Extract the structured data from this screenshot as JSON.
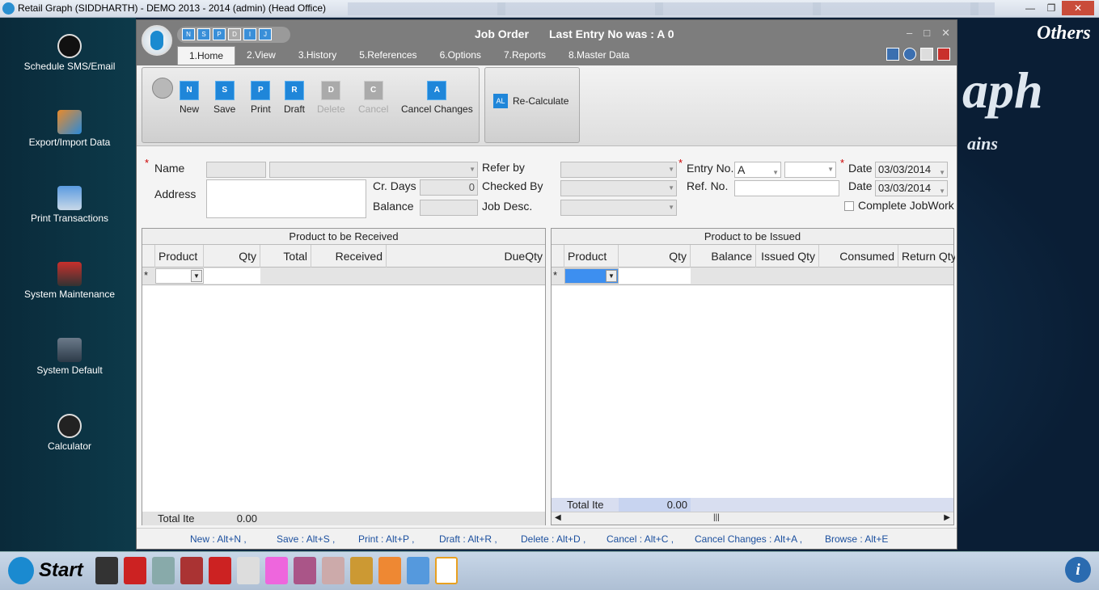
{
  "window": {
    "title": "Retail Graph (SIDDHARTH) - DEMO  2013 - 2014 (admin) (Head Office)"
  },
  "desktop": {
    "icons": [
      {
        "label": "Schedule SMS/Email",
        "icon": "clock-icon"
      },
      {
        "label": "Export/Import Data",
        "icon": "export-import-icon"
      },
      {
        "label": "Print Transactions",
        "icon": "printer-icon"
      },
      {
        "label": "System Maintenance",
        "icon": "maintenance-icon"
      },
      {
        "label": "System Default",
        "icon": "system-default-icon"
      },
      {
        "label": "Calculator",
        "icon": "calculator-icon"
      }
    ],
    "others": "Others",
    "brand_big": "aph",
    "brand_sub": "ains"
  },
  "app": {
    "title": "Job Order",
    "last_entry": "Last Entry No was : A 0",
    "tabs": [
      "1.Home",
      "2.View",
      "3.History",
      "5.References",
      "6.Options",
      "7.Reports",
      "8.Master Data"
    ],
    "ribbon": {
      "new": "New",
      "save": "Save",
      "print": "Print",
      "draft": "Draft",
      "delete": "Delete",
      "cancel": "Cancel",
      "cancel_changes": "Cancel Changes",
      "recalculate": "Re-Calculate"
    },
    "form": {
      "name_label": "Name",
      "address_label": "Address",
      "cr_days_label": "Cr. Days",
      "cr_days_value": "0",
      "balance_label": "Balance",
      "refer_by_label": "Refer by",
      "checked_by_label": "Checked By",
      "job_desc_label": "Job Desc.",
      "entry_no_label": "Entry No.",
      "entry_no_value": "A",
      "ref_no_label": "Ref. No.",
      "date_label": "Date",
      "date1": "03/03/2014",
      "date2": "03/03/2014",
      "complete_jobwork": "Complete JobWork"
    },
    "received": {
      "title": "Product to be Received",
      "columns": [
        "Product",
        "Qty",
        "Total Qty",
        "Received Qty",
        "DueQty"
      ],
      "total_label": "Total Ite",
      "total_value": "0.00"
    },
    "issued": {
      "title": "Product to be Issued",
      "columns": [
        "Product",
        "Qty",
        "Balance Qty",
        "Issued Qty",
        "Consumed Qty",
        "Return Qty"
      ],
      "total_label": "Total Ite",
      "total_value": "0.00"
    },
    "shortcuts": [
      "New : Alt+N ,",
      "Save : Alt+S ,",
      "Print : Alt+P ,",
      "Draft : Alt+R ,",
      "Delete : Alt+D ,",
      "Cancel : Alt+C ,",
      "Cancel Changes : Alt+A ,",
      "Browse : Alt+E"
    ]
  },
  "taskbar": {
    "start": "Start"
  }
}
